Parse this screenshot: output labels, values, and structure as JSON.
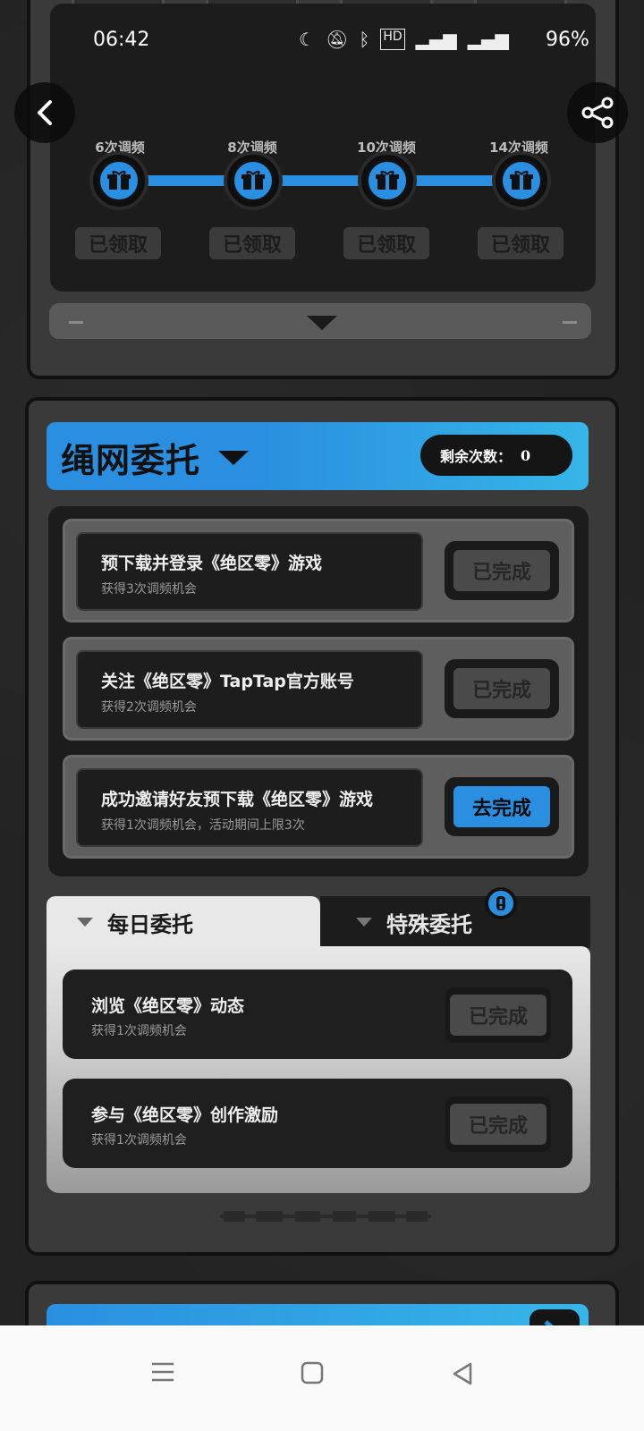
{
  "status": {
    "time": "06:42",
    "icons": [
      "moon-icon",
      "mute-icon",
      "bluetooth-icon",
      "hd-icon",
      "signal-5g-icon",
      "signal-5g-icon"
    ],
    "battery": "96%"
  },
  "rewards": {
    "tiers": [
      {
        "label": "6次调频",
        "status": "已领取"
      },
      {
        "label": "8次调频",
        "status": "已领取"
      },
      {
        "label": "10次调频",
        "status": "已领取"
      },
      {
        "label": "14次调频",
        "status": "已领取"
      }
    ]
  },
  "missions": {
    "title": "绳网委托",
    "remaining_label": "剩余次数：",
    "remaining_value": "0",
    "tasks": [
      {
        "title": "预下载并登录《绝区零》游戏",
        "subtitle": "获得3次调频机会",
        "button": "已完成"
      },
      {
        "title": "关注《绝区零》TapTap官方账号",
        "subtitle": "获得2次调频机会",
        "button": "已完成"
      },
      {
        "title": "成功邀请好友预下载《绝区零》游戏",
        "subtitle": "获得1次调频机会，活动期间上限3次",
        "button": "去完成"
      }
    ],
    "tabs": {
      "daily": "每日委托",
      "special": "特殊委托"
    },
    "daily_tasks": [
      {
        "title": "浏览《绝区零》动态",
        "subtitle": "获得1次调频机会",
        "button": "已完成"
      },
      {
        "title": "参与《绝区零》创作激励",
        "subtitle": "获得1次调频机会",
        "button": "已完成"
      }
    ]
  },
  "colors": {
    "accent": "#2a8fe0",
    "panel": "#3a3a3a",
    "dark": "#1c1c1c"
  }
}
